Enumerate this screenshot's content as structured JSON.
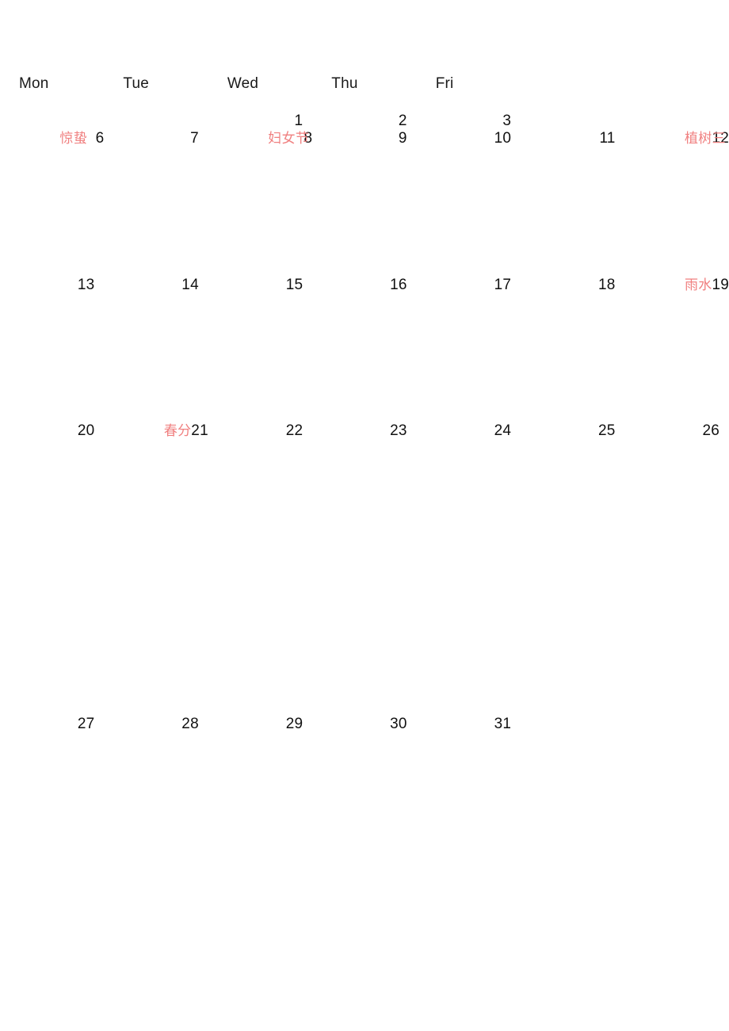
{
  "calendar": {
    "note_color": "#f08080",
    "day_color": "#111111",
    "weekday_headers": [
      {
        "label": "Mon"
      },
      {
        "label": "Tue"
      },
      {
        "label": "Wed"
      },
      {
        "label": "Thu"
      },
      {
        "label": "Fri"
      },
      {
        "label": ""
      },
      {
        "label": ""
      }
    ],
    "weeks": [
      {
        "days": [
          {
            "number": "",
            "note": ""
          },
          {
            "number": "",
            "note": ""
          },
          {
            "number": "1",
            "note": ""
          },
          {
            "number": "2",
            "note": ""
          },
          {
            "number": "3",
            "note": ""
          },
          {
            "number": "",
            "note": ""
          },
          {
            "number": "",
            "note": ""
          }
        ]
      },
      {
        "days": [
          {
            "number": "6",
            "note": "惊蛰"
          },
          {
            "number": "7",
            "note": ""
          },
          {
            "number": "8",
            "note": "妇女节"
          },
          {
            "number": "9",
            "note": ""
          },
          {
            "number": "10",
            "note": ""
          },
          {
            "number": "11",
            "note": ""
          },
          {
            "number": "12",
            "note": "植树三"
          }
        ]
      },
      {
        "days": [
          {
            "number": "13",
            "note": ""
          },
          {
            "number": "14",
            "note": ""
          },
          {
            "number": "15",
            "note": ""
          },
          {
            "number": "16",
            "note": ""
          },
          {
            "number": "17",
            "note": ""
          },
          {
            "number": "18",
            "note": ""
          },
          {
            "number": "19",
            "note": "雨水"
          }
        ]
      },
      {
        "days": [
          {
            "number": "20",
            "note": ""
          },
          {
            "number": "21",
            "note": "春分"
          },
          {
            "number": "22",
            "note": ""
          },
          {
            "number": "23",
            "note": ""
          },
          {
            "number": "24",
            "note": ""
          },
          {
            "number": "25",
            "note": ""
          },
          {
            "number": "26",
            "note": ""
          }
        ]
      },
      {
        "days": [
          {
            "number": "27",
            "note": ""
          },
          {
            "number": "28",
            "note": ""
          },
          {
            "number": "29",
            "note": ""
          },
          {
            "number": "30",
            "note": ""
          },
          {
            "number": "31",
            "note": ""
          },
          {
            "number": "",
            "note": ""
          },
          {
            "number": "",
            "note": ""
          }
        ]
      }
    ]
  }
}
